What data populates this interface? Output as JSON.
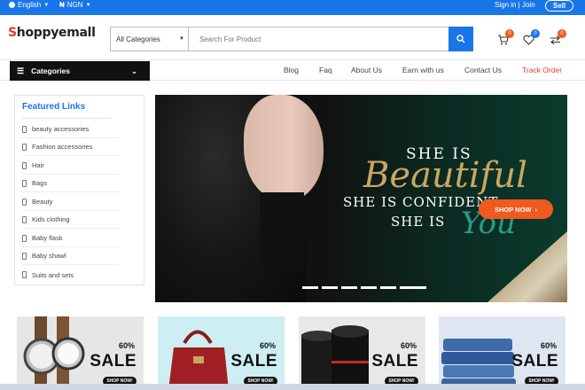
{
  "topbar": {
    "language": "English",
    "currency": "NGN",
    "signin": "Sign in | Join",
    "sell": "Sell"
  },
  "header": {
    "logo_first": "S",
    "logo_rest": "hoppyemall",
    "category_select": "All Categories",
    "search_placeholder": "Search For Product",
    "cart_count": "0",
    "wishlist_count": "0",
    "compare_count": "0"
  },
  "nav": {
    "categories": "Categories",
    "links": [
      "Blog",
      "Faq",
      "About Us",
      "Earn with us",
      "Contact Us",
      "Track Order"
    ]
  },
  "sidebar": {
    "title": "Featured Links",
    "items": [
      "beauty accessories",
      "Fashion accessories",
      "Hair",
      "Bags",
      "Beauty",
      "Kids clothing",
      "Baby flask",
      "Baby shawl",
      "Suits and sets"
    ]
  },
  "banner": {
    "line1": "SHE IS",
    "script1": "Beautiful",
    "line2": "SHE IS CONFIDENT",
    "line3": "SHE IS",
    "script2": "You",
    "cta": "SHOP NOW"
  },
  "promos": [
    {
      "pct": "60%",
      "sale": "SALE",
      "shop": "SHOP NOW!"
    },
    {
      "pct": "60%",
      "sale": "SALE",
      "shop": "SHOP NOW!"
    },
    {
      "pct": "60%",
      "sale": "SALE",
      "shop": "SHOP NOW!"
    },
    {
      "pct": "60%",
      "sale": "SALE",
      "shop": "SHOP NOW!"
    }
  ],
  "colors": {
    "brand_blue": "#1976e8",
    "accent_orange": "#f05a1f",
    "logo_red": "#e53935",
    "track_order": "#e53935"
  }
}
